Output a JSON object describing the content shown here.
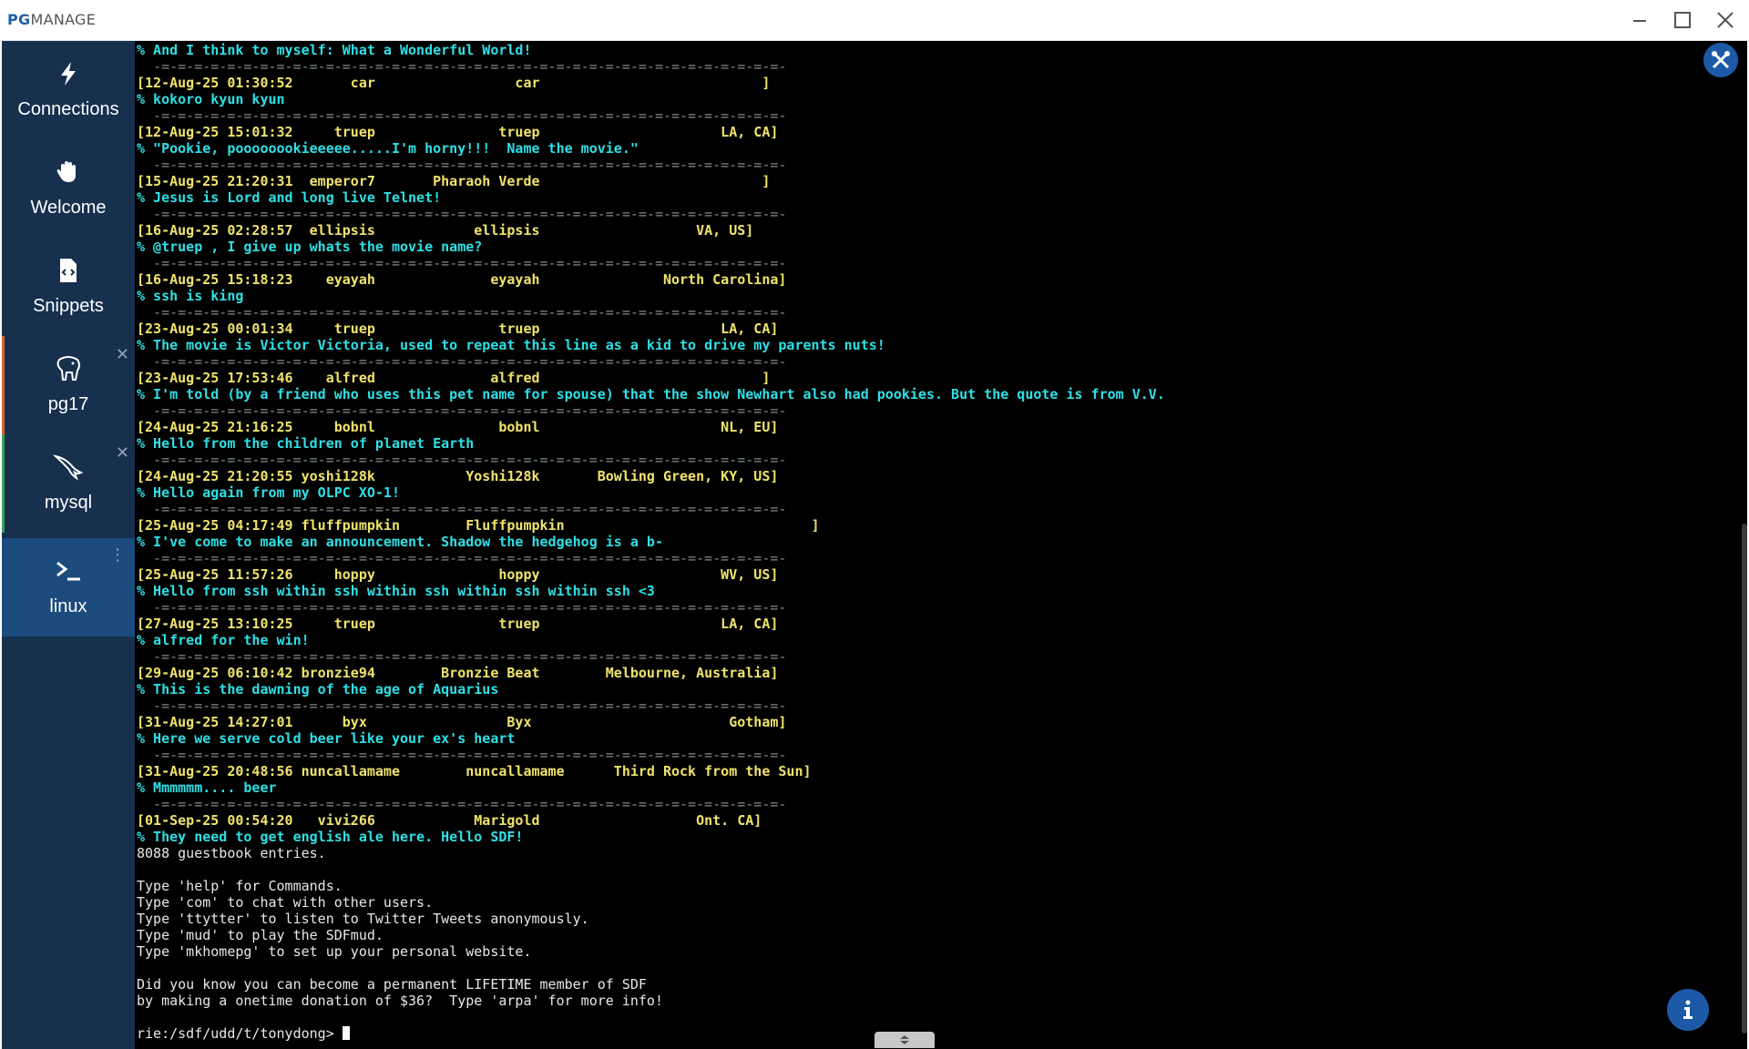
{
  "app": {
    "logo_bold": "PG",
    "logo_rest": "MANAGE"
  },
  "sidebar": {
    "items": [
      {
        "label": "Connections",
        "icon": "bolt-icon"
      },
      {
        "label": "Welcome",
        "icon": "wave-hand-icon"
      },
      {
        "label": "Snippets",
        "icon": "code-file-icon"
      },
      {
        "label": "pg17",
        "icon": "postgres-elephant-icon",
        "closable": true
      },
      {
        "label": "mysql",
        "icon": "mysql-dolphin-icon",
        "closable": true
      },
      {
        "label": "linux",
        "icon": "terminal-icon",
        "active": true
      }
    ]
  },
  "terminal": {
    "lines": [
      {
        "t": "% And I think to myself: What a Wonderful World!",
        "c": "cyan"
      },
      {
        "t": "  -=-=-=-=-=-=-=-=-=-=-=-=-=-=-=-=-=-=-=-=-=-=-=-=-=-=-=-=-=-=-=-=-=-=-=-=-=-=-",
        "c": "sep"
      },
      {
        "t": "[12-Aug-25 01:30:52       car                 car                           ]",
        "c": "yel"
      },
      {
        "t": "% kokoro kyun kyun",
        "c": "cyan"
      },
      {
        "t": "  -=-=-=-=-=-=-=-=-=-=-=-=-=-=-=-=-=-=-=-=-=-=-=-=-=-=-=-=-=-=-=-=-=-=-=-=-=-=-",
        "c": "sep"
      },
      {
        "t": "[12-Aug-25 15:01:32     truep               truep                      LA, CA]",
        "c": "yel"
      },
      {
        "t": "% \"Pookie, poooooookieeeee.....I'm horny!!!  Name the movie.\"",
        "c": "cyan"
      },
      {
        "t": "  -=-=-=-=-=-=-=-=-=-=-=-=-=-=-=-=-=-=-=-=-=-=-=-=-=-=-=-=-=-=-=-=-=-=-=-=-=-=-",
        "c": "sep"
      },
      {
        "t": "[15-Aug-25 21:20:31  emperor7       Pharaoh Verde                           ]",
        "c": "yel"
      },
      {
        "t": "% Jesus is Lord and long live Telnet!",
        "c": "cyan"
      },
      {
        "t": "  -=-=-=-=-=-=-=-=-=-=-=-=-=-=-=-=-=-=-=-=-=-=-=-=-=-=-=-=-=-=-=-=-=-=-=-=-=-=-",
        "c": "sep"
      },
      {
        "t": "[16-Aug-25 02:28:57  ellipsis            ellipsis                   VA, US]",
        "c": "yel"
      },
      {
        "t": "% @truep , I give up whats the movie name?",
        "c": "cyan"
      },
      {
        "t": "  -=-=-=-=-=-=-=-=-=-=-=-=-=-=-=-=-=-=-=-=-=-=-=-=-=-=-=-=-=-=-=-=-=-=-=-=-=-=-",
        "c": "sep"
      },
      {
        "t": "[16-Aug-25 15:18:23    eyayah              eyayah               North Carolina]",
        "c": "yel"
      },
      {
        "t": "% ssh is king",
        "c": "cyan"
      },
      {
        "t": "  -=-=-=-=-=-=-=-=-=-=-=-=-=-=-=-=-=-=-=-=-=-=-=-=-=-=-=-=-=-=-=-=-=-=-=-=-=-=-",
        "c": "sep"
      },
      {
        "t": "[23-Aug-25 00:01:34     truep               truep                      LA, CA]",
        "c": "yel"
      },
      {
        "t": "% The movie is Victor Victoria, used to repeat this line as a kid to drive my parents nuts!",
        "c": "cyan"
      },
      {
        "t": "  -=-=-=-=-=-=-=-=-=-=-=-=-=-=-=-=-=-=-=-=-=-=-=-=-=-=-=-=-=-=-=-=-=-=-=-=-=-=-",
        "c": "sep"
      },
      {
        "t": "[23-Aug-25 17:53:46    alfred              alfred                           ]",
        "c": "yel"
      },
      {
        "t": "% I'm told (by a friend who uses this pet name for spouse) that the show Newhart also had pookies. But the quote is from V.V.",
        "c": "cyan"
      },
      {
        "t": "  -=-=-=-=-=-=-=-=-=-=-=-=-=-=-=-=-=-=-=-=-=-=-=-=-=-=-=-=-=-=-=-=-=-=-=-=-=-=-",
        "c": "sep"
      },
      {
        "t": "[24-Aug-25 21:16:25     bobnl               bobnl                      NL, EU]",
        "c": "yel"
      },
      {
        "t": "% Hello from the children of planet Earth",
        "c": "cyan"
      },
      {
        "t": "  -=-=-=-=-=-=-=-=-=-=-=-=-=-=-=-=-=-=-=-=-=-=-=-=-=-=-=-=-=-=-=-=-=-=-=-=-=-=-",
        "c": "sep"
      },
      {
        "t": "[24-Aug-25 21:20:55 yoshi128k           Yoshi128k       Bowling Green, KY, US]",
        "c": "yel"
      },
      {
        "t": "% Hello again from my OLPC XO-1!",
        "c": "cyan"
      },
      {
        "t": "  -=-=-=-=-=-=-=-=-=-=-=-=-=-=-=-=-=-=-=-=-=-=-=-=-=-=-=-=-=-=-=-=-=-=-=-=-=-=-",
        "c": "sep"
      },
      {
        "t": "[25-Aug-25 04:17:49 fluffpumpkin        Fluffpumpkin                              ]",
        "c": "yel"
      },
      {
        "t": "% I've come to make an announcement. Shadow the hedgehog is a b-",
        "c": "cyan"
      },
      {
        "t": "  -=-=-=-=-=-=-=-=-=-=-=-=-=-=-=-=-=-=-=-=-=-=-=-=-=-=-=-=-=-=-=-=-=-=-=-=-=-=-",
        "c": "sep"
      },
      {
        "t": "[25-Aug-25 11:57:26     hoppy               hoppy                      WV, US]",
        "c": "yel"
      },
      {
        "t": "% Hello from ssh within ssh within ssh within ssh within ssh <3",
        "c": "cyan"
      },
      {
        "t": "  -=-=-=-=-=-=-=-=-=-=-=-=-=-=-=-=-=-=-=-=-=-=-=-=-=-=-=-=-=-=-=-=-=-=-=-=-=-=-",
        "c": "sep"
      },
      {
        "t": "[27-Aug-25 13:10:25     truep               truep                      LA, CA]",
        "c": "yel"
      },
      {
        "t": "% alfred for the win!",
        "c": "cyan"
      },
      {
        "t": "  -=-=-=-=-=-=-=-=-=-=-=-=-=-=-=-=-=-=-=-=-=-=-=-=-=-=-=-=-=-=-=-=-=-=-=-=-=-=-",
        "c": "sep"
      },
      {
        "t": "[29-Aug-25 06:10:42 bronzie94        Bronzie Beat        Melbourne, Australia]",
        "c": "yel"
      },
      {
        "t": "% This is the dawning of the age of Aquarius",
        "c": "cyan"
      },
      {
        "t": "  -=-=-=-=-=-=-=-=-=-=-=-=-=-=-=-=-=-=-=-=-=-=-=-=-=-=-=-=-=-=-=-=-=-=-=-=-=-=-",
        "c": "sep"
      },
      {
        "t": "[31-Aug-25 14:27:01      byx                 Byx                        Gotham]",
        "c": "yel"
      },
      {
        "t": "% Here we serve cold beer like your ex's heart",
        "c": "cyan"
      },
      {
        "t": "  -=-=-=-=-=-=-=-=-=-=-=-=-=-=-=-=-=-=-=-=-=-=-=-=-=-=-=-=-=-=-=-=-=-=-=-=-=-=-",
        "c": "sep"
      },
      {
        "t": "[31-Aug-25 20:48:56 nuncallamame        nuncallamame      Third Rock from the Sun]",
        "c": "yel"
      },
      {
        "t": "% Mmmmmm.... beer",
        "c": "cyan"
      },
      {
        "t": "  -=-=-=-=-=-=-=-=-=-=-=-=-=-=-=-=-=-=-=-=-=-=-=-=-=-=-=-=-=-=-=-=-=-=-=-=-=-=-",
        "c": "sep"
      },
      {
        "t": "[01-Sep-25 00:54:20   vivi266            Marigold                   Ont. CA]",
        "c": "yel"
      },
      {
        "t": "% They need to get english ale here. Hello SDF!",
        "c": "cyan"
      },
      {
        "t": "8088 guestbook entries.",
        "c": "wht"
      },
      {
        "t": "",
        "c": "wht"
      },
      {
        "t": "Type 'help' for Commands.",
        "c": "wht"
      },
      {
        "t": "Type 'com' to chat with other users.",
        "c": "wht"
      },
      {
        "t": "Type 'ttytter' to listen to Twitter Tweets anonymously.",
        "c": "wht"
      },
      {
        "t": "Type 'mud' to play the SDFmud.",
        "c": "wht"
      },
      {
        "t": "Type 'mkhomepg' to set up your personal website.",
        "c": "wht"
      },
      {
        "t": "",
        "c": "wht"
      },
      {
        "t": "Did you know you can become a permanent LIFETIME member of SDF",
        "c": "wht"
      },
      {
        "t": "by making a onetime donation of $36?  Type 'arpa' for more info!",
        "c": "wht"
      },
      {
        "t": "",
        "c": "wht"
      }
    ],
    "prompt": "rie:/sdf/udd/t/tonydong> "
  },
  "colors": {
    "sidebar": "#16304e",
    "sidebar_active": "#1c4b7e",
    "accent": "#1c5aa8",
    "pg17_stripe": "#d9662f",
    "mysql_stripe": "#3aa05a"
  }
}
